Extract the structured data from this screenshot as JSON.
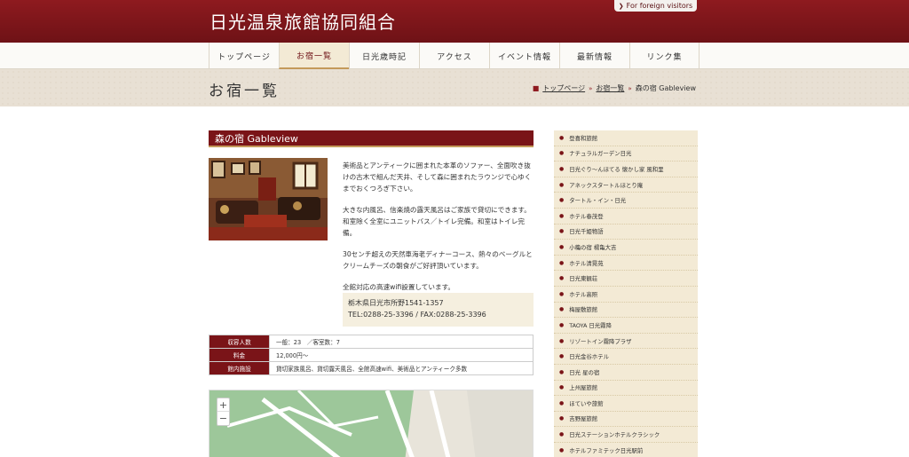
{
  "site": {
    "title": "日光温泉旅館協同組合",
    "foreign_label": "For foreign visitors"
  },
  "nav": [
    {
      "label": "トップページ",
      "active": false
    },
    {
      "label": "お宿一覧",
      "active": true
    },
    {
      "label": "日光歳時記",
      "active": false
    },
    {
      "label": "アクセス",
      "active": false
    },
    {
      "label": "イベント情報",
      "active": false
    },
    {
      "label": "最新情報",
      "active": false
    },
    {
      "label": "リンク集",
      "active": false
    }
  ],
  "band": {
    "title": "お宿一覧",
    "breadcrumb": {
      "home": "トップページ",
      "parent": "お宿一覧",
      "current": "森の宿 Gableview"
    }
  },
  "hotel": {
    "name": "森の宿 Gableview",
    "desc": [
      "美術品とアンティークに囲まれた本革のソファー、全面吹き抜けの古木で組んだ天井、そして森に囲まれたラウンジで心ゆくまでおくつろぎ下さい。",
      "大きな内風呂、信楽焼の露天風呂はご家族で貸切にできます。和室除く全室にユニットバス／トイレ完備。和室はトイレ完備。",
      "30センチ超えの天然車海老ディナーコース、熱々のベーグルとクリームチーズの朝食がご好評頂いています。",
      "全館対応の高速wifi設置しています。"
    ],
    "address": "栃木県日光市所野1541-1357",
    "contact": "TEL:0288-25-3396 / FAX:0288-25-3396",
    "info": [
      {
        "label": "収容人数",
        "value": "一般：23　／客室数：7"
      },
      {
        "label": "料金",
        "value": "12,000円〜"
      },
      {
        "label": "館内施設",
        "value": "貸切家族風呂、貸切露天風呂、全館高速wifi、美術品とアンティーク多数"
      }
    ]
  },
  "map": {
    "zoom_in": "+",
    "zoom_out": "−"
  },
  "sidebar": [
    "登喜和旅館",
    "ナチュラルガーデン日光",
    "日光ぐり～んほてる 懐かし家 風和里",
    "アネックスタートルほとり庵",
    "タートル・イン・日光",
    "ホテル春茂登",
    "日光千姫物語",
    "小穐の宿 楊亀大吉",
    "ホテル清晃苑",
    "日光東観荘",
    "ホテル高照",
    "梅屋敷旅館",
    "TAOYA 日光霧降",
    "リゾートイン霧降プラザ",
    "日光金谷ホテル",
    "日光 星の宿",
    "上州屋旅館",
    "ほていや旅館",
    "吉野屋旅館",
    "日光ステーションホテルクラシック",
    "ホテルファミテック日光駅前"
  ],
  "colors": {
    "brand": "#7a1418",
    "accent": "#c49a5a",
    "sidebar_bg": "#f3ead5"
  }
}
